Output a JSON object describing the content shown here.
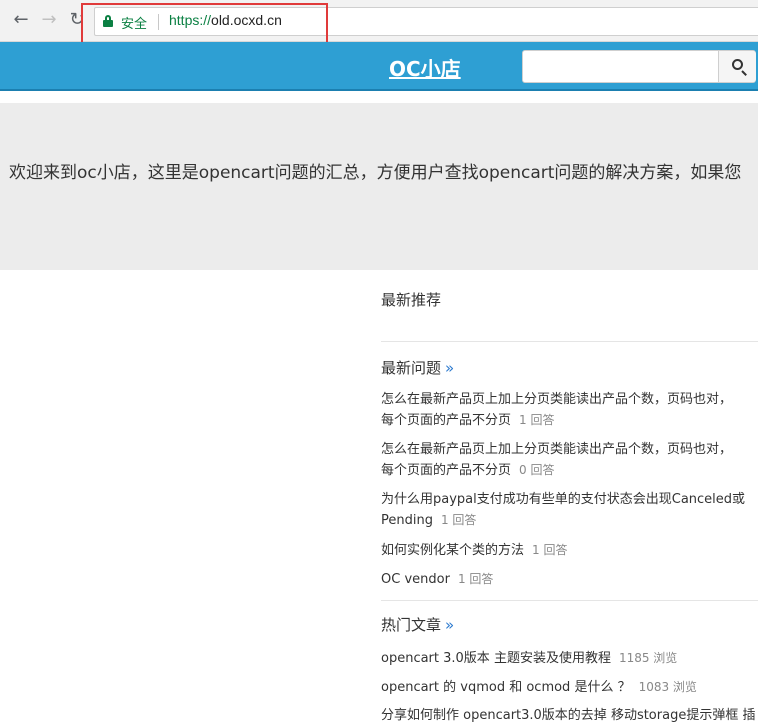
{
  "browser": {
    "secure_label": "安全",
    "url_scheme": "https://",
    "url_host": "old.ocxd.cn"
  },
  "header": {
    "logo": "OC小店",
    "search_placeholder": ""
  },
  "banner": {
    "text": "欢迎来到oc小店，这里是opencart问题的汇总，方便用户查找opencart问题的解决方案，如果您"
  },
  "sections": {
    "recommended": {
      "title": "最新推荐"
    },
    "latest_questions": {
      "title": "最新问题",
      "more": "»",
      "items": [
        {
          "line1": "怎么在最新产品页上加上分页类能读出产品个数，页码也对，",
          "line2": "每个页面的产品不分页",
          "meta": "1 回答"
        },
        {
          "line1": "怎么在最新产品页上加上分页类能读出产品个数，页码也对，",
          "line2": "每个页面的产品不分页",
          "meta": "0 回答"
        },
        {
          "line1": "为什么用paypal支付成功有些单的支付状态会出现Canceled或",
          "line2": "Pending",
          "meta": "1 回答"
        },
        {
          "line1": "如何实例化某个类的方法",
          "meta": "1 回答"
        },
        {
          "line1": "OC vendor",
          "meta": "1 回答"
        }
      ]
    },
    "hot_articles": {
      "title": "热门文章",
      "more": "»",
      "items": [
        {
          "text": "opencart 3.0版本 主题安装及使用教程",
          "meta": "1185 浏览"
        },
        {
          "text": "opencart 的 vqmod 和 ocmod 是什么 ？",
          "meta": "1083 浏览"
        },
        {
          "text": "分享如何制作 opencart3.0版本的去掉 移动storage提示弹框 插"
        }
      ]
    }
  },
  "colors": {
    "header_bg": "#2e9fd3",
    "secure_green": "#0b8043",
    "highlight_red": "#e03a3a",
    "banner_bg": "#ececec"
  }
}
